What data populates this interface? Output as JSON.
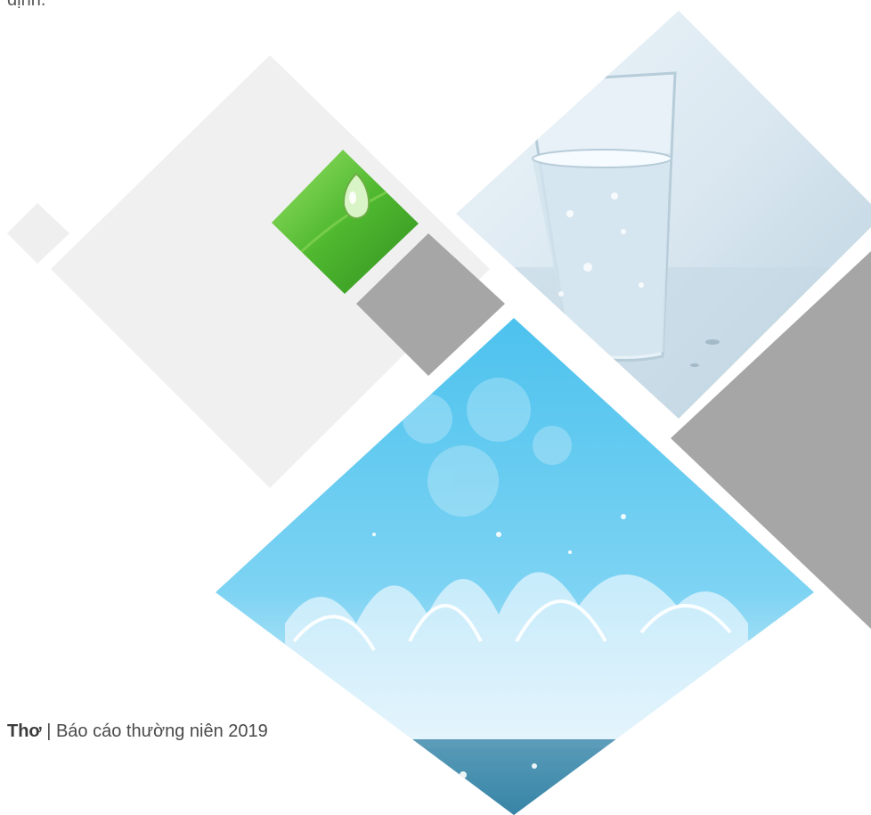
{
  "page": {
    "top_text": "định.",
    "footer": {
      "company": "Thơ",
      "separator": " | ",
      "report_title": "Báo cáo thường niên 2019"
    }
  },
  "images": [
    {
      "name": "leaf-water-drop-image",
      "description": "green leaf with a water droplet"
    },
    {
      "name": "glass-of-water-image",
      "description": "glass of water on a light background"
    },
    {
      "name": "water-splash-image",
      "description": "blue water splash with bubbles"
    }
  ],
  "colors": {
    "light-gray-shape": "#efefef",
    "dark-gray-shape": "#a6a6a6",
    "sky-blue": "#4fc3ec",
    "leaf-green": "#4caf2e"
  }
}
